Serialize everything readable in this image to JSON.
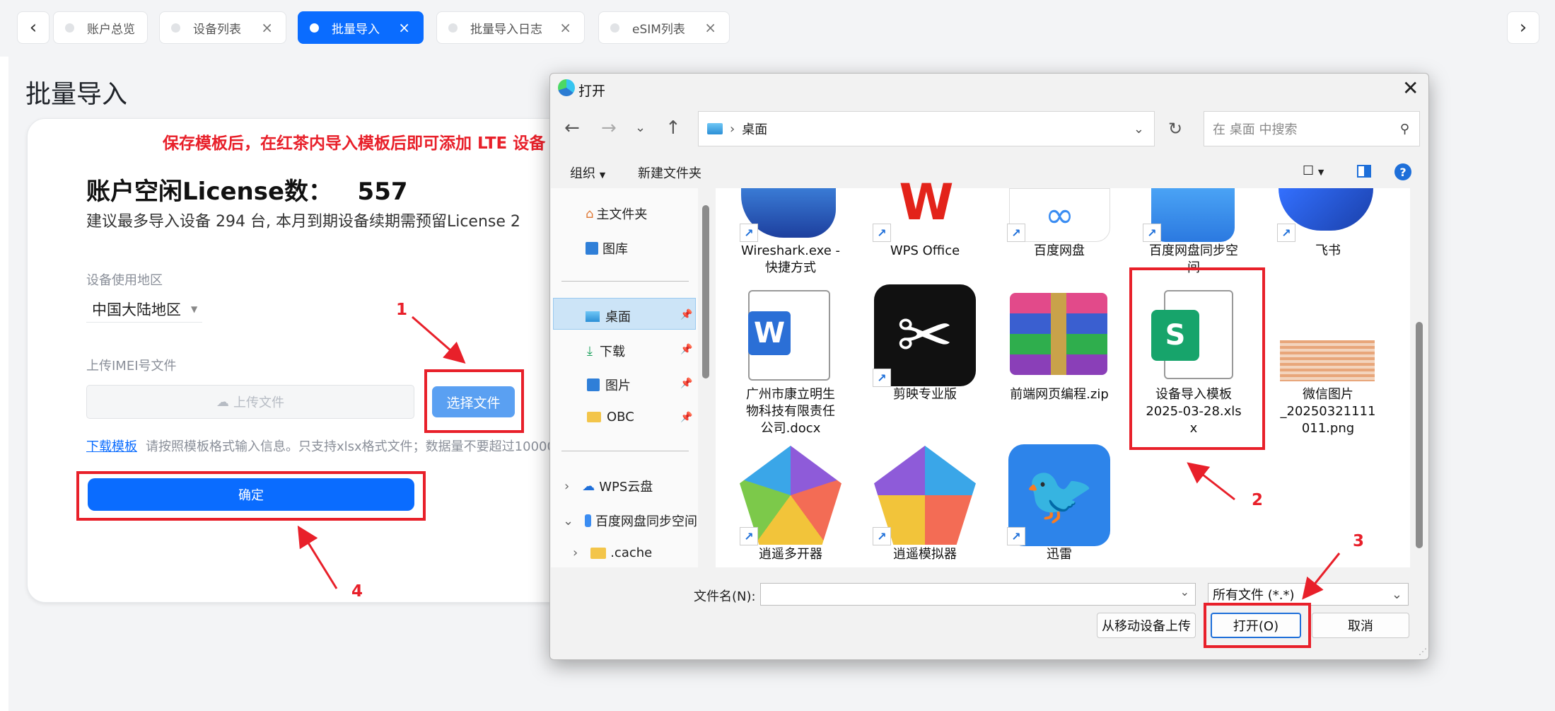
{
  "tabs": [
    {
      "label": "账户总览",
      "closable": false
    },
    {
      "label": "设备列表",
      "closable": true
    },
    {
      "label": "批量导入",
      "closable": true,
      "active": true
    },
    {
      "label": "批量导入日志",
      "closable": true
    },
    {
      "label": "eSIM列表",
      "closable": true
    }
  ],
  "page": {
    "title": "批量导入",
    "red_note": "保存模板后，在红茶内导入模板后即可添加 LTE 设备",
    "license_title": "账户空闲License数：   557",
    "license_sub": "建议最多导入设备 294 台, 本月到期设备续期需预留License 2",
    "region_label": "设备使用地区",
    "region_value": "中国大陆地区",
    "upload_label": "上传IMEI号文件",
    "upload_placeholder": "上传文件",
    "choose_file": "选择文件",
    "download_link": "下载模板",
    "hint": "请按照模板格式输入信息。只支持xlsx格式文件；数据量不要超过10000",
    "confirm": "确定"
  },
  "annotations": {
    "a1": "1",
    "a2": "2",
    "a3": "3",
    "a4": "4"
  },
  "dialog": {
    "title": "打开",
    "address": "桌面",
    "search_placeholder": "在 桌面 中搜索",
    "organize": "组织",
    "new_folder": "新建文件夹",
    "nav_tree": [
      "主文件夹",
      "图库",
      "桌面",
      "下载",
      "图片",
      "OBC",
      "WPS云盘",
      "百度网盘同步空间",
      ".cache"
    ],
    "files": [
      {
        "name": "Wireshark.exe -\n快捷方式"
      },
      {
        "name": "WPS Office"
      },
      {
        "name": "百度网盘"
      },
      {
        "name": "百度网盘同步空\n间"
      },
      {
        "name": "飞书"
      },
      {
        "name": "广州市康立明生\n物科技有限责任\n公司.docx"
      },
      {
        "name": "剪映专业版"
      },
      {
        "name": "前端网页编程.zip"
      },
      {
        "name": "设备导入模板\n2025-03-28.xls\nx"
      },
      {
        "name": "微信图片\n_20250321111\n011.png"
      },
      {
        "name": "逍遥多开器"
      },
      {
        "name": "逍遥模拟器"
      },
      {
        "name": "迅雷"
      }
    ],
    "filename_label": "文件名(N):",
    "filetype": "所有文件 (*.*)",
    "upload_mobile": "从移动设备上传",
    "open": "打开(O)",
    "cancel": "取消"
  },
  "colors": {
    "accent": "#0a6cff",
    "annotation": "#e8202a"
  }
}
